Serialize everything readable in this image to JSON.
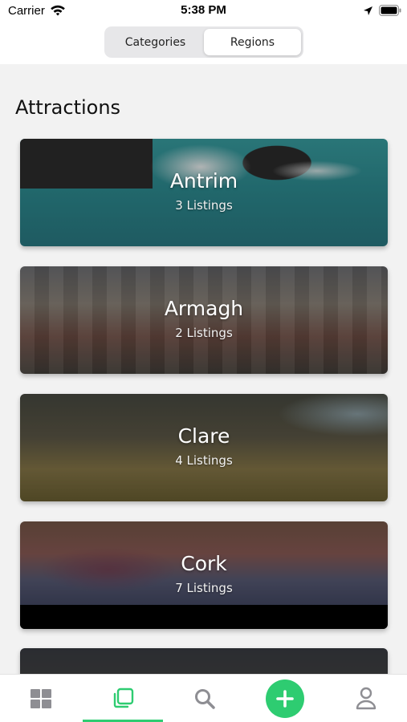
{
  "status_bar": {
    "carrier": "Carrier",
    "time": "5:38 PM"
  },
  "segment": {
    "options": [
      "Categories",
      "Regions"
    ],
    "selected": "Regions"
  },
  "section_title": "Attractions",
  "regions": [
    {
      "name": "Antrim",
      "listings": "3 Listings"
    },
    {
      "name": "Armagh",
      "listings": "2 Listings"
    },
    {
      "name": "Clare",
      "listings": "4 Listings"
    },
    {
      "name": "Cork",
      "listings": "7 Listings"
    }
  ],
  "tabbar": {
    "items": [
      "grid-icon",
      "layers-icon",
      "search-icon",
      "add-icon",
      "profile-icon"
    ],
    "active": "layers-icon"
  },
  "colors": {
    "accent": "#2ecc71",
    "icon_inactive": "#8e8e93"
  }
}
